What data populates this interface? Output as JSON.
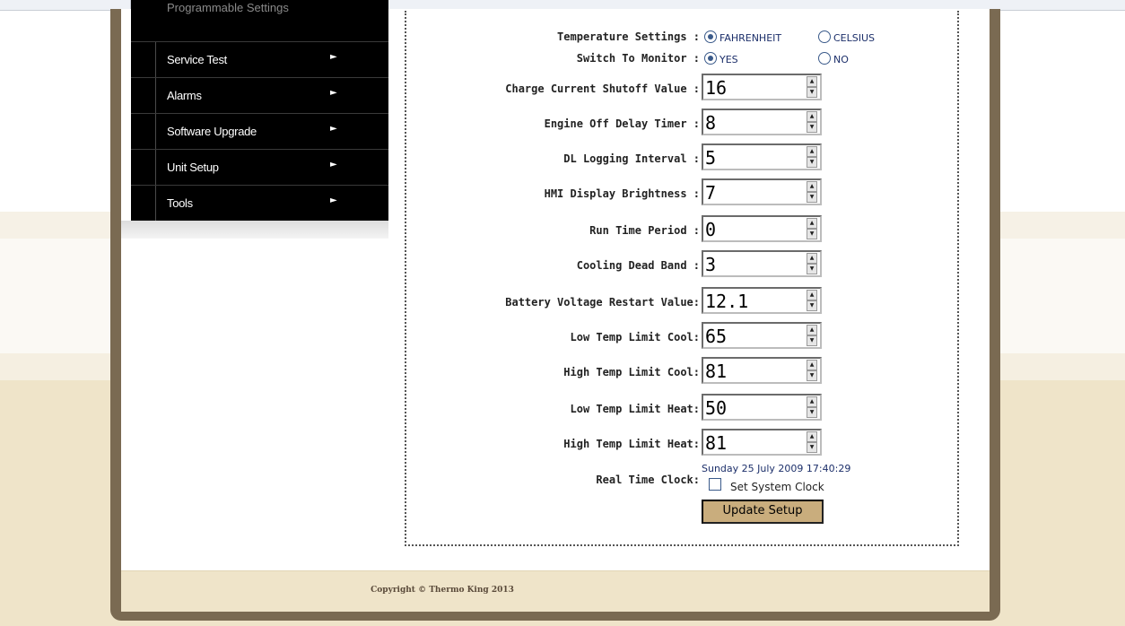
{
  "menu": {
    "top_partial": "Programmable Settings",
    "items": [
      {
        "label": "Service Test"
      },
      {
        "label": "Alarms"
      },
      {
        "label": "Software Upgrade"
      },
      {
        "label": "Unit Setup"
      },
      {
        "label": "Tools"
      }
    ]
  },
  "settings": {
    "temperature_settings": {
      "label": "Temperature Settings :",
      "options": [
        {
          "label": "FAHRENHEIT",
          "checked": true
        },
        {
          "label": "CELSIUS",
          "checked": false
        }
      ]
    },
    "switch_to_monitor": {
      "label": "Switch To Monitor :",
      "options": [
        {
          "label": "YES",
          "checked": true
        },
        {
          "label": "NO",
          "checked": false
        }
      ]
    },
    "fields": [
      {
        "label": "Charge Current Shutoff Value :",
        "value": "16"
      },
      {
        "label": "Engine Off Delay Timer :",
        "value": "8"
      },
      {
        "label": "DL Logging Interval :",
        "value": "5"
      },
      {
        "label": "HMI Display Brightness :",
        "value": "7"
      },
      {
        "label": "Run Time Period :",
        "value": "0"
      },
      {
        "label": "Cooling Dead Band :",
        "value": "3"
      },
      {
        "label": "Battery Voltage Restart Value:",
        "value": "12.1"
      },
      {
        "label": "Low Temp Limit Cool:",
        "value": "65"
      },
      {
        "label": "High Temp Limit Cool:",
        "value": "81"
      },
      {
        "label": "Low Temp Limit Heat:",
        "value": "50"
      },
      {
        "label": "High Temp Limit Heat:",
        "value": "81"
      }
    ],
    "real_time_clock": {
      "label": "Real Time Clock:",
      "value": "Sunday 25 July 2009 17:40:29",
      "set_system_clock_label": "Set System Clock",
      "set_system_clock_checked": false
    },
    "update_button_label": "Update Setup"
  },
  "footer": {
    "copyright": "Copyright © Thermo King 2013"
  },
  "colors": {
    "frame": "#7a6a52",
    "footer_bg": "#efe4c9",
    "button_bg": "#c9ad7d",
    "menu_bg": "#000000",
    "radio_text": "#1c2f6a"
  }
}
